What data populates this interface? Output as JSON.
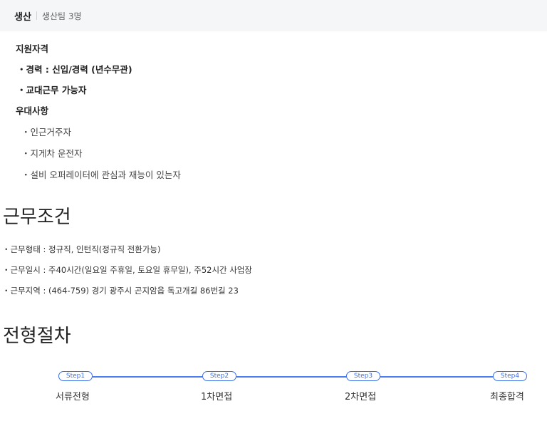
{
  "department": {
    "name": "생산",
    "team": "생산팀 3명"
  },
  "requirements": {
    "qualification_heading": "지원자격",
    "qualifications": [
      "・경력 : 신입/경력 (년수무관)",
      "・교대근무 가능자"
    ],
    "preferred_heading": "우대사항",
    "preferred": [
      "・인근거주자",
      "・지게차 운전자",
      "・설비 오퍼레이터에 관심과 재능이 있는자"
    ]
  },
  "conditions": {
    "title": "근무조건",
    "items": [
      "・근무형태 : 정규직, 인턴직(정규직 전환가능)",
      "・근무일시 : 주40시간(일요일 주휴일, 토요일 휴무일), 주52시간 사업장",
      "・근무지역 : (464-759) 경기 광주시 곤지암읍 독고개길 86번길 23"
    ]
  },
  "process": {
    "title": "전형절차",
    "steps": [
      {
        "badge": "Step1",
        "label": "서류전형"
      },
      {
        "badge": "Step2",
        "label": "1차면접"
      },
      {
        "badge": "Step3",
        "label": "2차면접"
      },
      {
        "badge": "Step4",
        "label": "최종합격"
      }
    ]
  },
  "colors": {
    "accent": "#3a6fe8",
    "header_bg": "#f5f6f8"
  }
}
